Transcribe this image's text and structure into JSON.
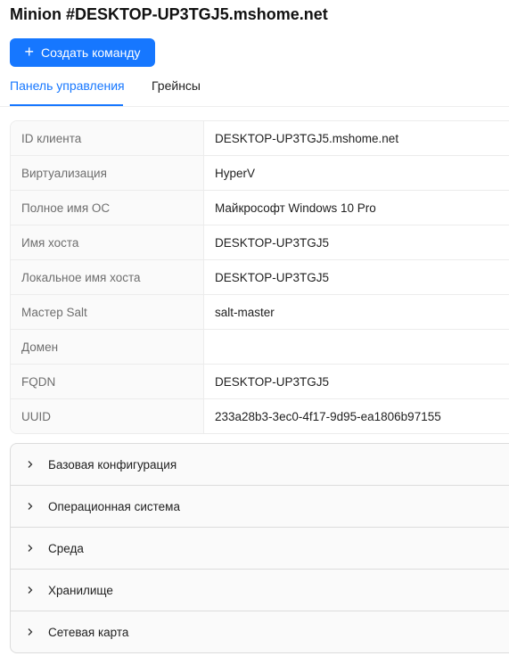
{
  "header": {
    "title": "Minion #DESKTOP-UP3TGJ5.mshome.net",
    "create_button_label": "Создать команду",
    "create_button_icon": "plus-icon"
  },
  "tabs": [
    {
      "label": "Панель управления",
      "active": true
    },
    {
      "label": "Грейнсы",
      "active": false
    }
  ],
  "info": [
    {
      "label": "ID клиента",
      "value": "DESKTOP-UP3TGJ5.mshome.net"
    },
    {
      "label": "Виртуализация",
      "value": "HyperV"
    },
    {
      "label": "Полное имя ОС",
      "value": "Майкрософт Windows 10 Pro"
    },
    {
      "label": "Имя хоста",
      "value": "DESKTOP-UP3TGJ5"
    },
    {
      "label": "Локальное имя хоста",
      "value": "DESKTOP-UP3TGJ5"
    },
    {
      "label": "Мастер Salt",
      "value": "salt-master"
    },
    {
      "label": "Домен",
      "value": ""
    },
    {
      "label": "FQDN",
      "value": "DESKTOP-UP3TGJ5"
    },
    {
      "label": "UUID",
      "value": "233a28b3-3ec0-4f17-9d95-ea1806b97155"
    }
  ],
  "sections": [
    {
      "label": "Базовая конфигурация",
      "icon": "chevron-right-icon"
    },
    {
      "label": "Операционная система",
      "icon": "chevron-right-icon"
    },
    {
      "label": "Среда",
      "icon": "chevron-right-icon"
    },
    {
      "label": "Хранилище",
      "icon": "chevron-right-icon"
    },
    {
      "label": "Сетевая карта",
      "icon": "chevron-right-icon"
    }
  ],
  "colors": {
    "accent": "#1677ff",
    "label_bg": "#fafafa",
    "border": "#ececec"
  }
}
